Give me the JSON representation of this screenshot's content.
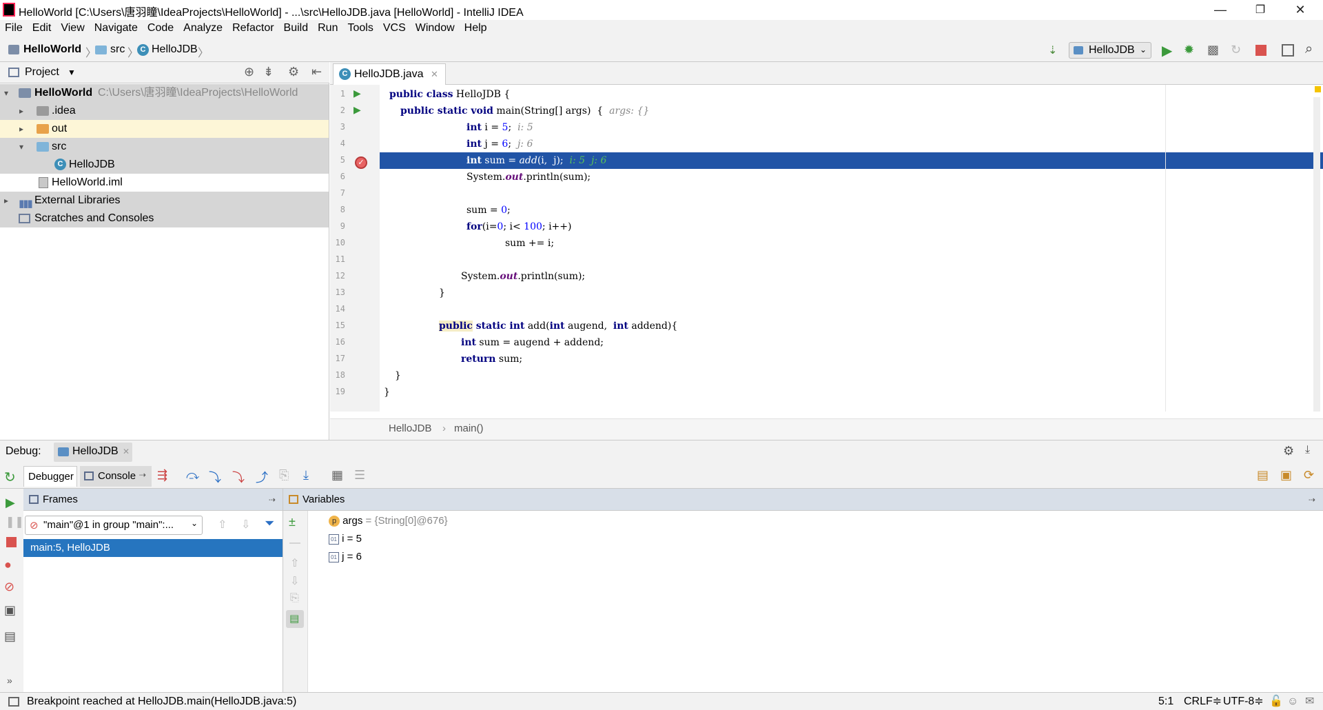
{
  "window": {
    "title": "HelloWorld [C:\\Users\\唐羽瞳\\IdeaProjects\\HelloWorld] - ...\\src\\HelloJDB.java [HelloWorld] - IntelliJ IDEA",
    "min": "—",
    "max": "❐",
    "close": "✕"
  },
  "menu": [
    "File",
    "Edit",
    "View",
    "Navigate",
    "Code",
    "Analyze",
    "Refactor",
    "Build",
    "Run",
    "Tools",
    "VCS",
    "Window",
    "Help"
  ],
  "nav": {
    "crumbs": [
      "HelloWorld",
      "src",
      "HelloJDB"
    ],
    "run_config": "HelloJDB"
  },
  "project": {
    "header": "Project",
    "tree": [
      {
        "label": "HelloWorld",
        "path": "C:\\Users\\唐羽瞳\\IdeaProjects\\HelloWorld"
      },
      {
        "label": ".idea"
      },
      {
        "label": "out"
      },
      {
        "label": "src"
      },
      {
        "label": "HelloJDB"
      },
      {
        "label": "HelloWorld.iml"
      },
      {
        "label": "External Libraries"
      },
      {
        "label": "Scratches and Consoles"
      }
    ]
  },
  "editor": {
    "tab": "HelloJDB.java",
    "line_numbers": [
      "1",
      "2",
      "3",
      "4",
      "5",
      "6",
      "7",
      "8",
      "9",
      "10",
      "11",
      "12",
      "13",
      "14",
      "15",
      "16",
      "17",
      "18",
      "19"
    ],
    "lines": {
      "l1": {
        "kw": "public class",
        "rest": " HelloJDB {"
      },
      "l2": {
        "kw": "public static void",
        "rest": " main(String[] args)  {  ",
        "hint": "args: {}"
      },
      "l3": {
        "kw": "int",
        "a": " i = ",
        "num": "5",
        "b": ";  ",
        "hint": "i: 5"
      },
      "l4": {
        "kw": "int",
        "a": " j = ",
        "num": "6",
        "b": ";  ",
        "hint": "j: 6"
      },
      "l5": {
        "kw": "int",
        "a": " sum = ",
        "fn": "add",
        "b": "(i,  j);  ",
        "hint": "i: 5  j: 6"
      },
      "l6": {
        "a": "System.",
        "field": "out",
        "b": ".println(sum);"
      },
      "l8": {
        "a": "sum = ",
        "num": "0",
        "b": ";"
      },
      "l9": {
        "kw": "for",
        "a": "(i=",
        "num1": "0",
        "b": "; i< ",
        "num2": "100",
        "c": "; i++)"
      },
      "l10": {
        "a": "sum += i;"
      },
      "l12": {
        "a": "System.",
        "field": "out",
        "b": ".println(sum);"
      },
      "l13": {
        "a": "}"
      },
      "l15": {
        "kw1": "public",
        "kw2": " static int",
        "a": " add(",
        "kw3": "int",
        "b": " augend,  ",
        "kw4": "int",
        "c": " addend){"
      },
      "l16": {
        "kw": "int",
        "a": " sum = augend + addend;"
      },
      "l17": {
        "kw": "return",
        "a": " sum;"
      },
      "l18": {
        "a": "}"
      },
      "l19": {
        "a": "}"
      }
    },
    "breadcrumb": [
      "HelloJDB",
      "main()"
    ]
  },
  "debug": {
    "label": "Debug:",
    "session_tab": "HelloJDB",
    "tabs": [
      "Debugger",
      "Console"
    ],
    "frames": {
      "header": "Frames",
      "thread": "\"main\"@1 in group \"main\":...",
      "selected_frame": "main:5, HelloJDB"
    },
    "variables": {
      "header": "Variables",
      "items": [
        {
          "badge": "p",
          "name": "args",
          "value": " = {String[0]@676}"
        },
        {
          "badge": "01",
          "name": "i",
          "value": " = 5"
        },
        {
          "badge": "01",
          "name": "j",
          "value": " = 6"
        }
      ]
    }
  },
  "status": {
    "message": "Breakpoint reached at HelloJDB.main(HelloJDB.java:5)",
    "position": "5:1",
    "line_sep": "CRLF≑",
    "encoding": "UTF-8≑"
  },
  "colors": {
    "selection": "#2154a6",
    "frame_selected": "#2675bf",
    "run_green": "#3c9a3c",
    "stop_red": "#d9534f"
  }
}
